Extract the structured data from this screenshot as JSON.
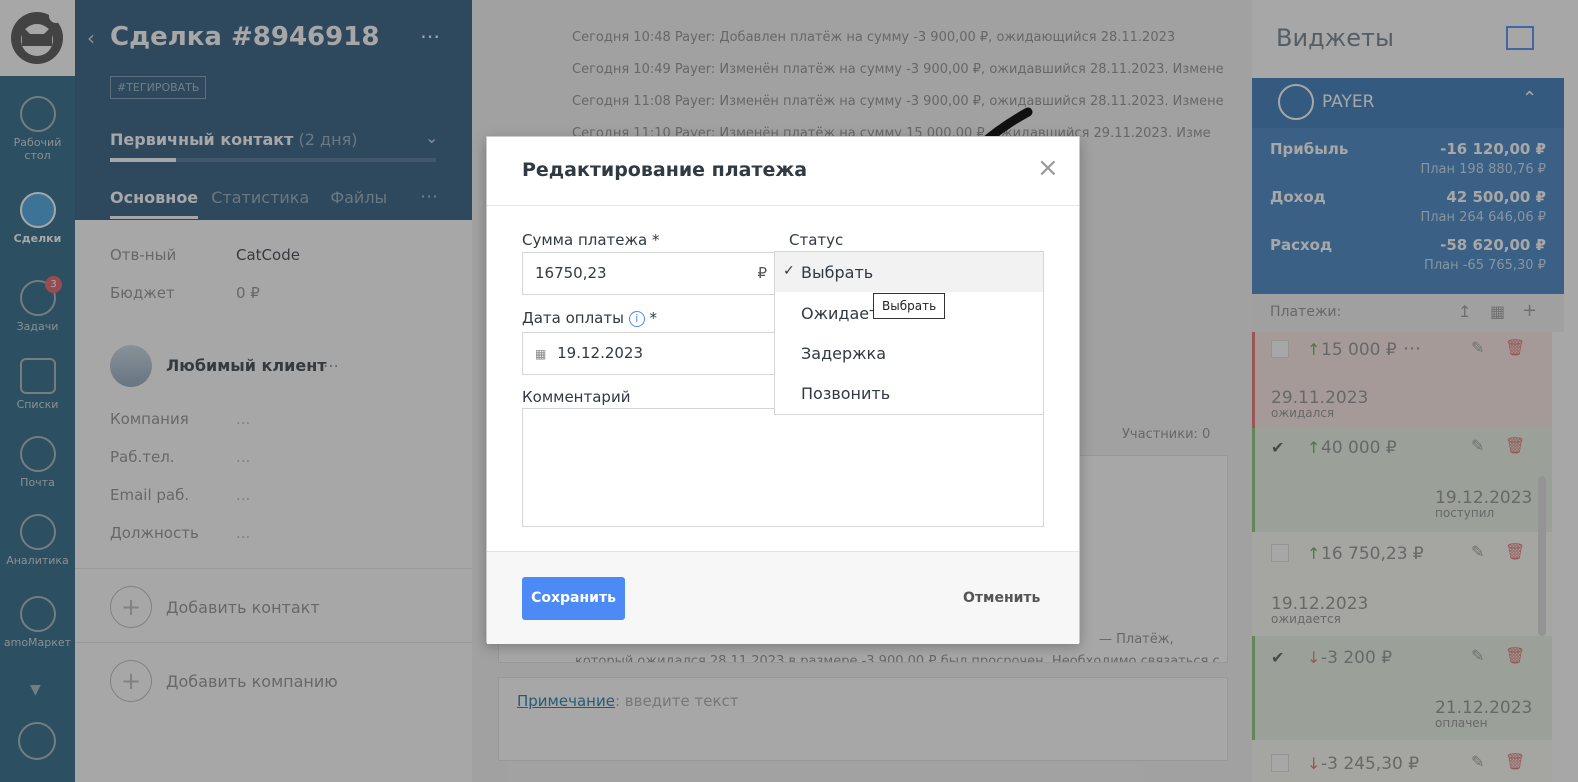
{
  "nav": {
    "items": [
      {
        "label": "Рабочий стол",
        "icon": "dashboard-icon"
      },
      {
        "label": "Сделки",
        "icon": "deals-icon"
      },
      {
        "label": "Задачи",
        "icon": "tasks-icon",
        "badge": "3"
      },
      {
        "label": "Списки",
        "icon": "lists-icon"
      },
      {
        "label": "Почта",
        "icon": "mail-icon"
      },
      {
        "label": "Аналитика",
        "icon": "analytics-icon"
      },
      {
        "label": "amoМаркет",
        "icon": "market-icon"
      }
    ]
  },
  "deal": {
    "title": "Сделка #8946918",
    "tag_button": "#ТЕГИРОВАТЬ",
    "stage": "Первичный контакт",
    "stage_days": "(2 дня)",
    "tabs": [
      "Основное",
      "Статистика",
      "Файлы"
    ],
    "fields": [
      {
        "label": "Отв-ный",
        "value": "CatCode"
      },
      {
        "label": "Бюджет",
        "value": "0 ₽"
      }
    ],
    "contact_name": "Любимый клиент",
    "contact_fields": [
      {
        "label": "Компания",
        "value": "..."
      },
      {
        "label": "Раб.тел.",
        "value": "..."
      },
      {
        "label": "Email раб.",
        "value": "..."
      },
      {
        "label": "Должность",
        "value": "..."
      }
    ],
    "add_contact": "Добавить контакт",
    "add_company": "Добавить компанию"
  },
  "feed": {
    "lines": [
      "Сегодня 10:48 Payer: Добавлен платёж на сумму -3 900,00 ₽, ожидающийся 28.11.2023",
      "Сегодня 10:49 Payer: Изменён платёж на сумму -3 900,00 ₽, ожидавшийся 28.11.2023. Измене",
      "Сегодня 11:08 Payer: Изменён платёж на сумму -3 900,00 ₽, ожидавшийся 28.11.2023. Измене",
      "Сегодня 11:10 Payer: Изменён платёж на сумму 15 000,00 ₽, ожидавшийся 29.11.2023. Изме"
    ],
    "participants": "Участники: 0",
    "note_link": "Примечание",
    "note_placeholder": ": введите текст",
    "bottom_text_1": "— Платёж,",
    "bottom_text_2": "который ожидался 28.11.2023 в размере -3 900,00 ₽ был просрочен. Необходимо связаться с"
  },
  "widgets": {
    "title": "Виджеты",
    "payer_name": "PAYER",
    "summary": [
      {
        "label": "Прибыль",
        "value": "-16 120,00 ₽",
        "plan": "План 198 880,76 ₽"
      },
      {
        "label": "Доход",
        "value": "42 500,00 ₽",
        "plan": "План 264 646,06 ₽"
      },
      {
        "label": "Расход",
        "value": "-58 620,00 ₽",
        "plan": "План -65 765,30 ₽"
      }
    ],
    "payments_label": "Платежи:",
    "payments": [
      {
        "amount": "15 000 ₽",
        "date": "29.11.2023",
        "status": "ожидался",
        "bg": "#fde8e6",
        "checked": false,
        "dir": "up"
      },
      {
        "amount": "40 000 ₽",
        "date": "19.12.2023",
        "status": "поступил",
        "bg": "#eaf5e4",
        "checked": true,
        "dir": "up"
      },
      {
        "amount": "16 750,23 ₽",
        "date": "19.12.2023",
        "status": "ожидается",
        "bg": "#fbfbf6",
        "checked": false,
        "dir": "up"
      },
      {
        "amount": "-3 200 ₽",
        "date": "21.12.2023",
        "status": "оплачен",
        "bg": "#eaf5e4",
        "checked": true,
        "dir": "down"
      },
      {
        "amount": "-3 245,30 ₽",
        "date": "",
        "status": "",
        "bg": "#fbfbf6",
        "checked": false,
        "dir": "down"
      }
    ]
  },
  "modal": {
    "title": "Редактирование платежа",
    "amount_label": "Сумма платежа *",
    "amount_value": "16750,23",
    "currency": "₽",
    "date_label": "Дата оплаты",
    "date_required": "*",
    "date_value": "19.12.2023",
    "status_label": "Статус",
    "comment_label": "Комментарий",
    "save_label": "Сохранить",
    "cancel_label": "Отменить",
    "status_options": [
      "Выбрать",
      "Ожидается",
      "Задержка",
      "Позвонить"
    ],
    "status_options_visible": [
      "Выбрать",
      "Ожидаетс",
      "Задержка",
      "Позвонить"
    ],
    "tooltip": "Выбрать"
  },
  "colors": {
    "accent": "#4c8bf5",
    "nav_bg": "#1f5f80",
    "widget_blue": "#2f73b6"
  }
}
